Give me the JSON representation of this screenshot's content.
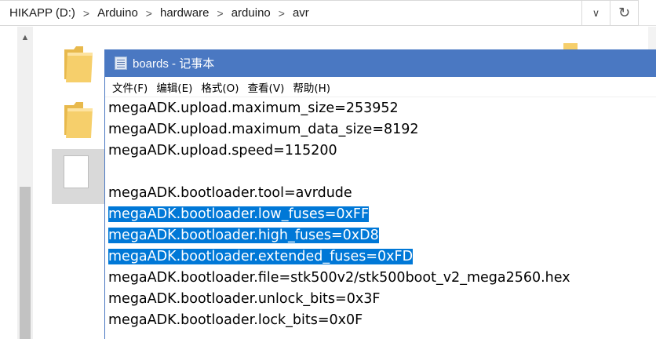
{
  "explorer": {
    "breadcrumb": [
      "HIKAPP (D:)",
      "Arduino",
      "hardware",
      "arduino",
      "avr"
    ],
    "separator": ">",
    "dropdown_glyph": "∨",
    "refresh_glyph": "↻",
    "scroll_up_glyph": "▲"
  },
  "notepad": {
    "title": "boards - 记事本",
    "menu": [
      "文件(F)",
      "编辑(E)",
      "格式(O)",
      "查看(V)",
      "帮助(H)"
    ],
    "lines": [
      {
        "text": "megaADK.upload.maximum_size=253952",
        "selected": false
      },
      {
        "text": "megaADK.upload.maximum_data_size=8192",
        "selected": false
      },
      {
        "text": "megaADK.upload.speed=115200",
        "selected": false
      },
      {
        "text": "",
        "selected": false
      },
      {
        "text": "megaADK.bootloader.tool=avrdude",
        "selected": false
      },
      {
        "text": "megaADK.bootloader.low_fuses=0xFF",
        "selected": true
      },
      {
        "text": "megaADK.bootloader.high_fuses=0xD8",
        "selected": true
      },
      {
        "text": "megaADK.bootloader.extended_fuses=0xFD",
        "selected": true
      },
      {
        "text": "megaADK.bootloader.file=stk500v2/stk500boot_v2_mega2560.hex",
        "selected": false
      },
      {
        "text": "megaADK.bootloader.unlock_bits=0x3F",
        "selected": false
      },
      {
        "text": "megaADK.bootloader.lock_bits=0x0F",
        "selected": false
      }
    ]
  },
  "colors": {
    "title_bar": "#4a78c2",
    "selection": "#0078d7",
    "folder": "#f6cf6b"
  }
}
